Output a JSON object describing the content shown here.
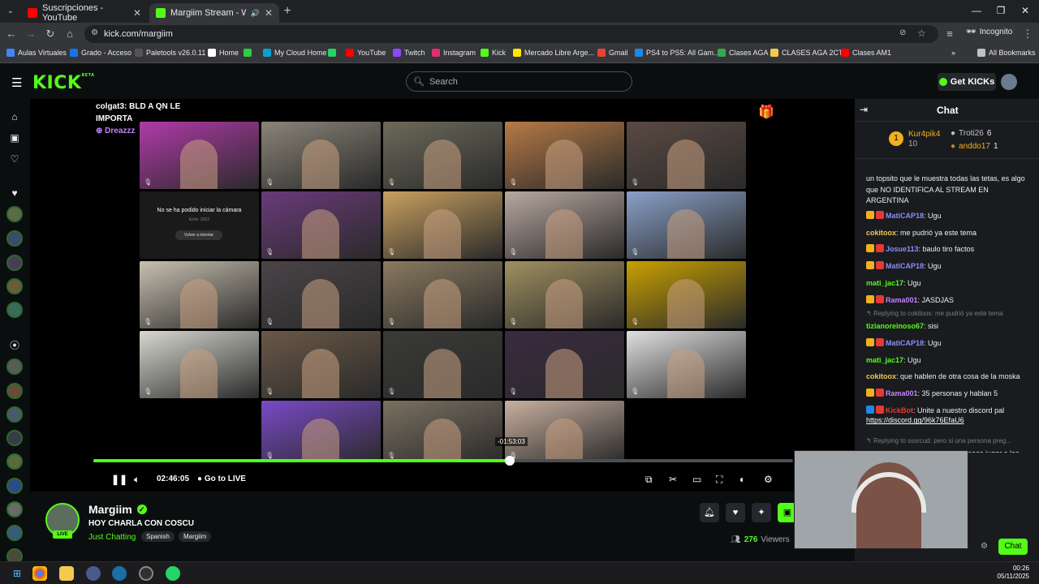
{
  "browser": {
    "tabs": [
      {
        "title": "Suscripciones - YouTube",
        "active": false
      },
      {
        "title": "Margiim Stream - Watch Li",
        "active": true
      }
    ],
    "url": "kick.com/margiim",
    "incognito_label": "Incognito",
    "bookmarks": [
      "Aulas Virtuales",
      "Grado - Acceso",
      "Paletools v26.0.11",
      "Home",
      "",
      "My Cloud Home",
      "",
      "YouTube",
      "Twitch",
      "Instagram",
      "Kick",
      "Mercado Libre Arge...",
      "Gmail",
      "PS4 to PS5: All Gam...",
      "Clases AGA",
      "CLASES AGA 2CT",
      "Clases AM1"
    ],
    "all_bookmarks": "All Bookmarks"
  },
  "kick": {
    "logo": "KICK",
    "logo_sup": "BETA",
    "search_placeholder": "Search",
    "get_kicks": "Get KICKs"
  },
  "player": {
    "overlay_line1": "colgat3: BLD A QN LE IMPORTA",
    "overlay_line2": "Dreazzz",
    "camera_error_title": "No se ha podido iniciar la cámara",
    "camera_error_code": "Error: 2012",
    "camera_retry": "Volver a intentar",
    "time": "02:46:05",
    "go_live": "Go to LIVE",
    "seek_tooltip": "-01:53:03",
    "progress": 0.595
  },
  "channel": {
    "name": "Margiim",
    "live_badge": "LIVE",
    "stream_title": "HOY CHARLA CON COSCU",
    "category": "Just Chatting",
    "tags": [
      "Spanish",
      "Margiim"
    ],
    "viewers": "276",
    "viewers_label": "Viewers"
  },
  "chat": {
    "title": "Chat",
    "gifters": [
      {
        "name": "Kur4pik4",
        "count": "10"
      },
      {
        "name": "Troti26",
        "count": "6"
      },
      {
        "name": "anddo17",
        "count": "1"
      }
    ],
    "truncated_top": "un topsito que le muestra todas las tetas, es algo que NO IDENTIFICA AL STREAM EN ARGENTINA",
    "messages": [
      {
        "user": "MatiCAP18",
        "text": ": Ugu",
        "color": "#8b8ffd"
      },
      {
        "user": "cokitoox",
        "text": ": me pudrió ya este tema",
        "color": "#f2c94c"
      },
      {
        "user": "Josue113",
        "text": ": baulo tiro factos",
        "color": "#8b8ffd"
      },
      {
        "user": "MatiCAP18",
        "text": ": Ugu",
        "color": "#8b8ffd"
      },
      {
        "user": "mati_jac17",
        "text": ": Ugu",
        "color": "#53fc18"
      },
      {
        "user": "Rama001",
        "text": ": JASDJAS",
        "color": "#c084fc"
      },
      {
        "reply": "Replying to cokitoox: me pudrió ya este tema"
      },
      {
        "user": "tizianoreinoso67",
        "text": ": sisi",
        "color": "#53fc18"
      },
      {
        "user": "MatiCAP18",
        "text": ": Ugu",
        "color": "#8b8ffd"
      },
      {
        "user": "mati_jac17",
        "text": ": Ugu",
        "color": "#53fc18"
      },
      {
        "user": "cokitoox",
        "text": ": que hablen de otra cosa de la moska",
        "color": "#f2c94c"
      },
      {
        "user": "Rama001",
        "text": ": 35 personas y hablan 5",
        "color": "#c084fc"
      },
      {
        "user": "KickBot",
        "text": ": Unite a nuestro discord pal",
        "color": "#e53935"
      },
      {
        "link": "https://discord.gg/96k76EfaU6"
      },
      {
        "reply": "Replying to sssrcud: pero si una persona preg..."
      },
      {
        "user": "Enzo_prada",
        "text": ": jajajajajajaja. tampoco jugar a los",
        "color": "#53fc18"
      }
    ],
    "chat_button": "Chat"
  },
  "taskbar": {
    "time": "00:26",
    "date": "05/11/2025"
  },
  "colors": {
    "brand": "#53fc18",
    "background": "#0b0e0f",
    "chat_bg": "#191b1f"
  }
}
